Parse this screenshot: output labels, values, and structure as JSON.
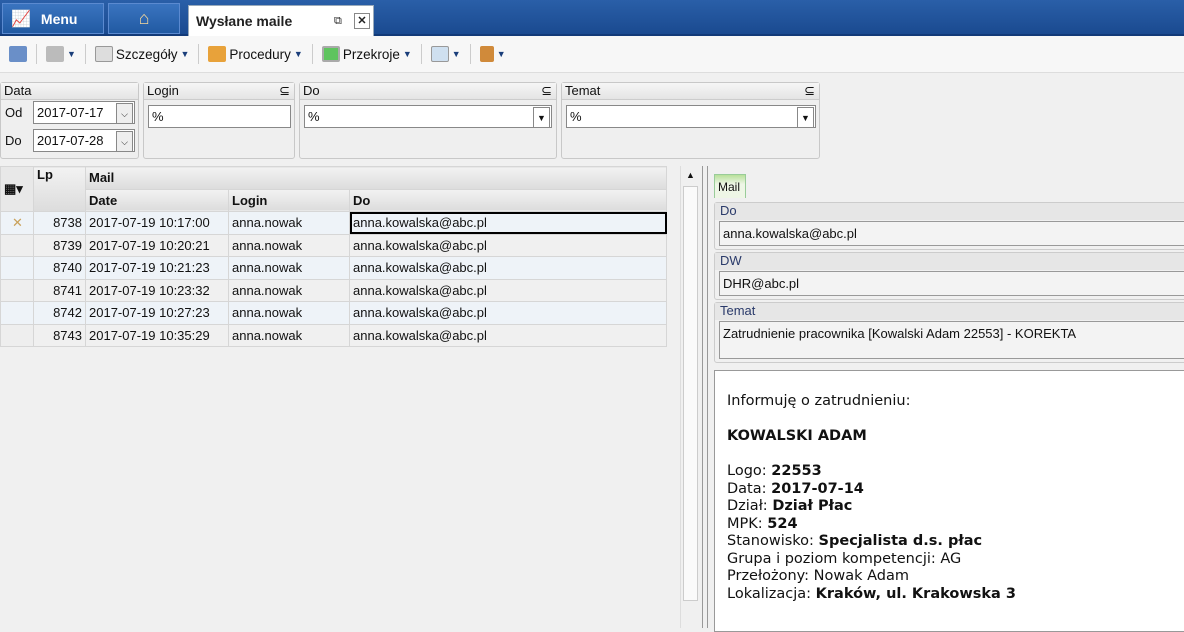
{
  "topbar": {
    "menu": "Menu",
    "tab_title": "Wysłane maile"
  },
  "toolbar": {
    "details": "Szczegóły",
    "procedures": "Procedury",
    "sections": "Przekroje"
  },
  "filters": {
    "data": {
      "label": "Data",
      "from_label": "Od",
      "from": "2017-07-17",
      "to_label": "Do",
      "to": "2017-07-28"
    },
    "login": {
      "label": "Login",
      "value": "%"
    },
    "do": {
      "label": "Do",
      "value": "%"
    },
    "temat": {
      "label": "Temat",
      "value": "%"
    }
  },
  "grid": {
    "headers": {
      "lp": "Lp",
      "mail": "Mail",
      "date": "Date",
      "login": "Login",
      "do": "Do"
    },
    "rows": [
      {
        "lp": "8738",
        "date": "2017-07-19 10:17:00",
        "login": "anna.nowak",
        "do": "anna.kowalska@abc.pl"
      },
      {
        "lp": "8739",
        "date": "2017-07-19 10:20:21",
        "login": "anna.nowak",
        "do": "anna.kowalska@abc.pl"
      },
      {
        "lp": "8740",
        "date": "2017-07-19 10:21:23",
        "login": "anna.nowak",
        "do": "anna.kowalska@abc.pl"
      },
      {
        "lp": "8741",
        "date": "2017-07-19 10:23:32",
        "login": "anna.nowak",
        "do": "anna.kowalska@abc.pl"
      },
      {
        "lp": "8742",
        "date": "2017-07-19 10:27:23",
        "login": "anna.nowak",
        "do": "anna.kowalska@abc.pl"
      },
      {
        "lp": "8743",
        "date": "2017-07-19 10:35:29",
        "login": "anna.nowak",
        "do": "anna.kowalska@abc.pl"
      }
    ]
  },
  "detail": {
    "tab": "Mail",
    "do_label": "Do",
    "do": "anna.kowalska@abc.pl",
    "dw_label": "DW",
    "dw": "DHR@abc.pl",
    "temat_label": "Temat",
    "temat": "Zatrudnienie pracownika [Kowalski Adam 22553] - KOREKTA",
    "body": {
      "intro": "Informuję o zatrudnieniu:",
      "name": "KOWALSKI ADAM",
      "lines": [
        {
          "k": "Logo: ",
          "v": "22553",
          "bold": true
        },
        {
          "k": "Data: ",
          "v": "2017-07-14",
          "bold": true
        },
        {
          "k": "Dział: ",
          "v": "Dział Płac",
          "bold": true
        },
        {
          "k": "MPK: ",
          "v": "524",
          "bold": true
        },
        {
          "k": "Stanowisko: ",
          "v": "Specjalista d.s. płac",
          "bold": true
        },
        {
          "k": "Grupa i poziom kompetencji: ",
          "v": "AG",
          "bold": false
        },
        {
          "k": "Przełożony: ",
          "v": "Nowak Adam",
          "bold": false
        },
        {
          "k": "Lokalizacja: ",
          "v": "Kraków, ul. Krakowska 3",
          "bold": true
        }
      ]
    }
  }
}
